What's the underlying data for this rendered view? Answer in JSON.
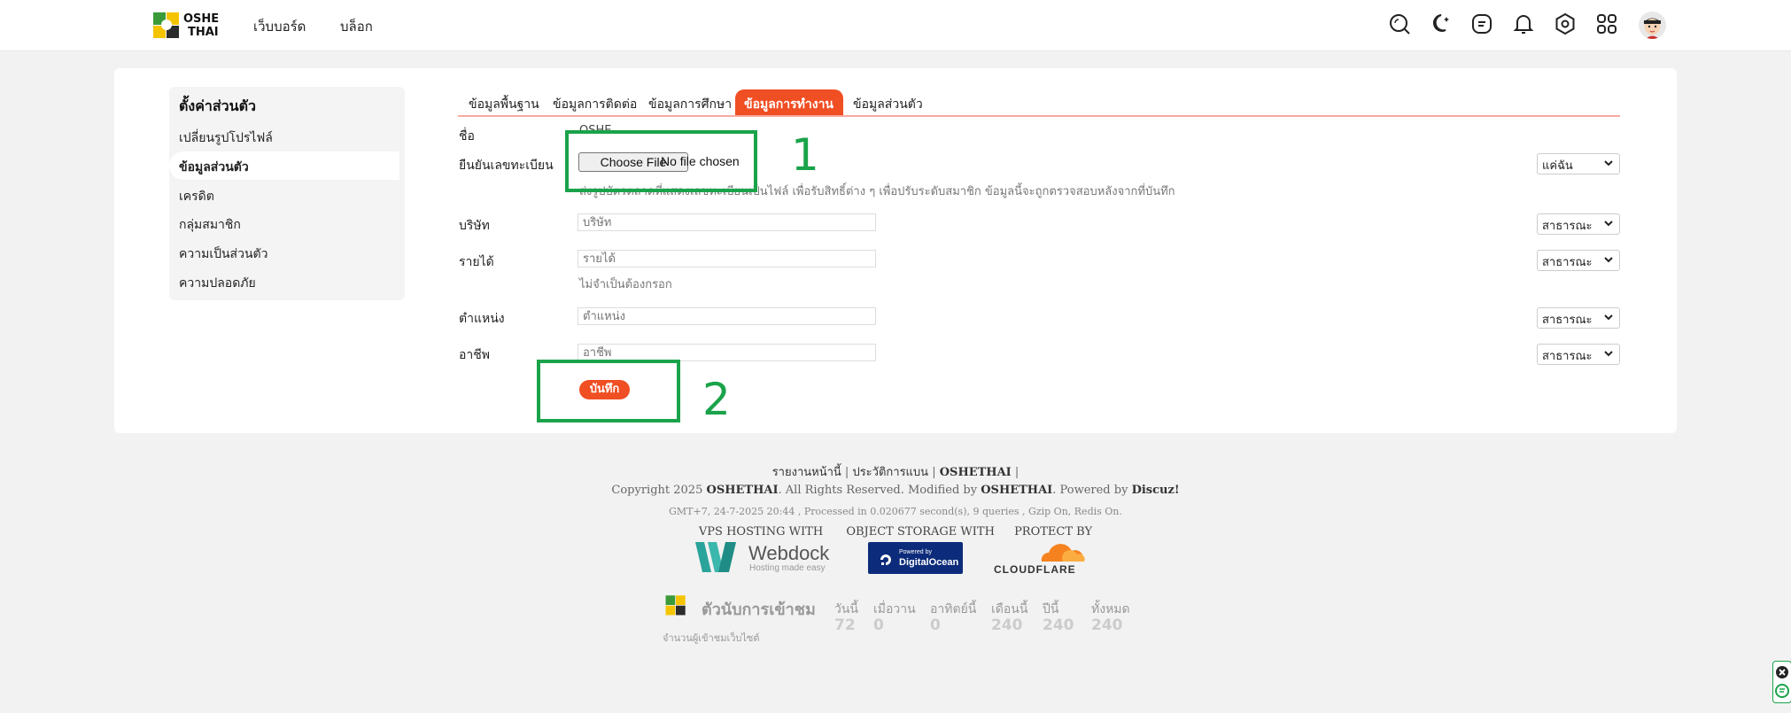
{
  "header": {
    "logo_line1": "OSHE",
    "logo_line2": "THAI",
    "nav": [
      "เว็บบอร์ด",
      "บล็อก"
    ],
    "icons": [
      "search-icon",
      "moon-icon",
      "message-icon",
      "bell-icon",
      "settings-icon",
      "apps-icon"
    ]
  },
  "sidebar": {
    "title": "ตั้งค่าส่วนตัว",
    "items": [
      {
        "label": "เปลี่ยนรูปโปรไฟล์"
      },
      {
        "label": "ข้อมูลส่วนตัว",
        "active": true
      },
      {
        "label": "เครดิต"
      },
      {
        "label": "กลุ่มสมาชิก"
      },
      {
        "label": "ความเป็นส่วนตัว"
      },
      {
        "label": "ความปลอดภัย"
      }
    ]
  },
  "tabs": [
    {
      "label": "ข้อมูลพื้นฐาน"
    },
    {
      "label": "ข้อมูลการติดต่อ"
    },
    {
      "label": "ข้อมูลการศึกษา"
    },
    {
      "label": "ข้อมูลการทำงาน",
      "active": true
    },
    {
      "label": "ข้อมูลส่วนตัว"
    }
  ],
  "form": {
    "name_label": "ชื่อ",
    "name_value": "OSHE",
    "verify_label": "ยืนยันเลขทะเบียน",
    "file_button": "Choose File",
    "file_status": "No file chosen",
    "verify_hint": "ส่งรูปบัตรตลาดที่แสดงเลขทะเบียนเป็นไฟล์ เพื่อรับสิทธิ์ต่าง ๆ เพื่อปรับระดับสมาชิก ข้อมูลนี้จะถูกตรวจสอบหลังจากที่บันทึก",
    "verify_privacy": "แค่ฉัน",
    "company_label": "บริษัท",
    "company_placeholder": "บริษัท",
    "company_privacy": "สาธารณะ",
    "income_label": "รายได้",
    "income_placeholder": "รายได้",
    "income_hint": "ไม่จำเป็นต้องกรอก",
    "income_privacy": "สาธารณะ",
    "position_label": "ตำแหน่ง",
    "position_placeholder": "ตำแหน่ง",
    "position_privacy": "สาธารณะ",
    "occupation_label": "อาชีพ",
    "occupation_placeholder": "อาชีพ",
    "occupation_privacy": "สาธารณะ",
    "save_label": "บันทึก"
  },
  "annotations": {
    "box1_number": "1",
    "box2_number": "2"
  },
  "footer": {
    "links": [
      "รายงานหน้านี้",
      "ประวัติการแบน",
      "OSHETHAI"
    ],
    "copyright_prefix": "Copyright 2025",
    "copyright_brand": "OSHETHAI",
    "copyright_mid": ". All Rights Reserved. Modified by",
    "modified_by": "OSHETHAI",
    "powered_prefix": ". Powered by",
    "powered_by": "Discuz!",
    "process_info": "GMT+7, 24-7-2025 20:44 , Processed in 0.020677 second(s), 9 queries , Gzip On, Redis On.",
    "hosting_labels": [
      "VPS HOSTING WITH",
      "OBJECT STORAGE WITH",
      "PROTECT BY"
    ],
    "webdock_name": "Webdock",
    "webdock_tagline": "Hosting made easy",
    "do_small": "Powered by",
    "do_name": "DigitalOcean",
    "cloudflare": "CLOUDFLARE",
    "stats_title": "ตัวนับการเข้าชม",
    "stats_caption": "จำนวนผู้เข้าชมเว็บไซต์",
    "stats": [
      {
        "label": "วันนี้",
        "value": "72"
      },
      {
        "label": "เมื่อวาน",
        "value": "0"
      },
      {
        "label": "อาทิตย์นี้",
        "value": "0"
      },
      {
        "label": "เดือนนี้",
        "value": "240"
      },
      {
        "label": "ปีนี้",
        "value": "240"
      },
      {
        "label": "ทั้งหมด",
        "value": "240"
      }
    ]
  },
  "colors": {
    "accent": "#f04e23",
    "annotation": "#1aa34a"
  }
}
